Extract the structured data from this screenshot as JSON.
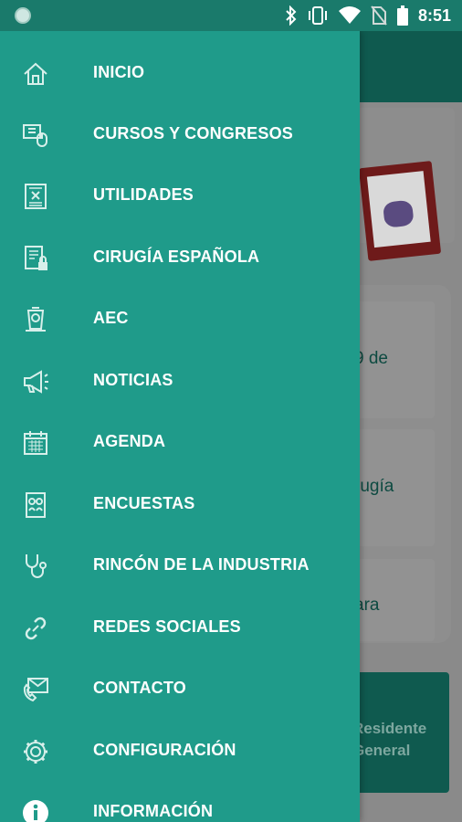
{
  "status_bar": {
    "time": "8:51",
    "icons": [
      "app-notification-icon",
      "bluetooth-icon",
      "vibrate-icon",
      "wifi-icon",
      "no-sim-icon",
      "battery-icon"
    ]
  },
  "background": {
    "card_text_1": "9 de",
    "card_text_2": "rugía",
    "card_text_3": "ara",
    "button_text_line1": "Residente",
    "button_text_line2": "General"
  },
  "drawer": {
    "accent_color": "#1f9b8a",
    "items": [
      {
        "label": "INICIO",
        "icon": "home-icon"
      },
      {
        "label": "CURSOS Y CONGRESOS",
        "icon": "courses-icon"
      },
      {
        "label": "UTILIDADES",
        "icon": "utilities-icon"
      },
      {
        "label": "CIRUGÍA ESPAÑOLA",
        "icon": "journal-lock-icon"
      },
      {
        "label": "AEC",
        "icon": "aec-emblem-icon"
      },
      {
        "label": "NOTICIAS",
        "icon": "megaphone-icon"
      },
      {
        "label": "AGENDA",
        "icon": "calendar-icon"
      },
      {
        "label": "ENCUESTAS",
        "icon": "survey-icon"
      },
      {
        "label": "RINCÓN DE LA INDUSTRIA",
        "icon": "stethoscope-icon"
      },
      {
        "label": "REDES SOCIALES",
        "icon": "link-icon"
      },
      {
        "label": "CONTACTO",
        "icon": "contact-icon"
      },
      {
        "label": "CONFIGURACIÓN",
        "icon": "gear-icon"
      },
      {
        "label": "INFORMACIÓN",
        "icon": "info-icon"
      }
    ]
  }
}
